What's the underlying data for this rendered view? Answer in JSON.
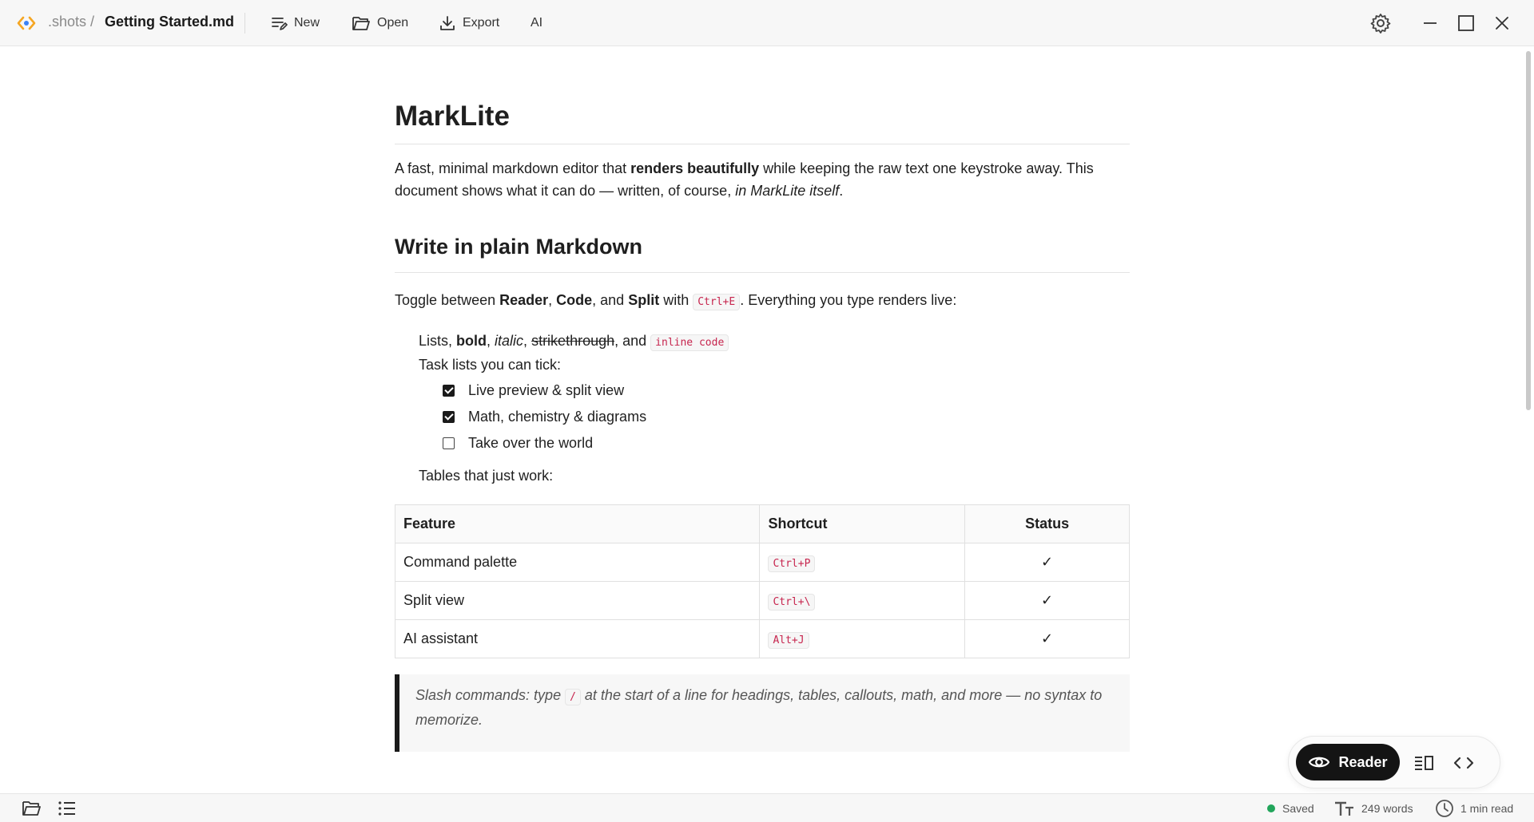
{
  "titlebar": {
    "crumb_dir": ".shots /",
    "crumb_file": "Getting Started.md",
    "new_label": "New",
    "open_label": "Open",
    "export_label": "Export",
    "ai_label": "AI",
    "accent_color": "#f5a623"
  },
  "doc": {
    "title": "MarkLite",
    "intro": {
      "t1": "A fast, minimal markdown editor that ",
      "b1": "renders beautifully",
      "t2": " while keeping the raw text one keystroke away. This document shows what it can do — written, of course, ",
      "i1": "in MarkLite itself",
      "t3": "."
    },
    "h2": "Write in plain Markdown",
    "toggle": {
      "t1": "Toggle between ",
      "b1": "Reader",
      "s1": ", ",
      "b2": "Code",
      "s2": ", and ",
      "b3": "Split",
      "s3": " with ",
      "code": "Ctrl+E",
      "t2": ". Everything you type renders live:"
    },
    "list1": {
      "t1": "Lists, ",
      "bold": "bold",
      "s1": ", ",
      "italic": "italic",
      "s2": ", ",
      "strike": "strikethrough",
      "s3": ", and ",
      "code": "inline code"
    },
    "task_label": "Task lists you can tick:",
    "tasks": [
      {
        "label": "Live preview & split view",
        "checked": true
      },
      {
        "label": "Math, chemistry & diagrams",
        "checked": true
      },
      {
        "label": "Take over the world",
        "checked": false
      }
    ],
    "tables_label": "Tables that just work:",
    "table": {
      "headers": [
        "Feature",
        "Shortcut",
        "Status"
      ],
      "rows": [
        {
          "feature": "Command palette",
          "shortcut": "Ctrl+P",
          "status": "✓"
        },
        {
          "feature": "Split view",
          "shortcut": "Ctrl+\\",
          "status": "✓"
        },
        {
          "feature": "AI assistant",
          "shortcut": "Alt+J",
          "status": "✓"
        }
      ]
    },
    "callout": {
      "t1": "Slash commands: type ",
      "code": "/",
      "t2": " at the start of a line for headings, tables, callouts, math, and more — no syntax to memorize."
    }
  },
  "modes": {
    "reader_label": "Reader"
  },
  "status": {
    "saved": "Saved",
    "words": "249 words",
    "read_time": "1 min read",
    "saved_color": "#22a55b"
  }
}
